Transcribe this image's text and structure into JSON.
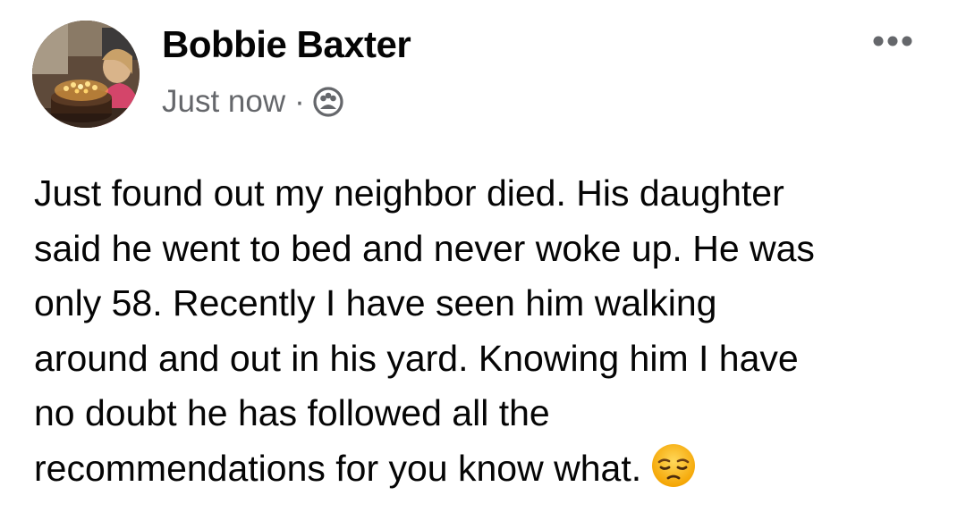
{
  "post": {
    "author": {
      "name": "Bobbie Baxter",
      "avatar_icon": "profile-photo-birthday-cake"
    },
    "meta": {
      "timestamp": "Just now",
      "separator": "·",
      "audience_icon": "friends-audience-icon"
    },
    "menu_icon": "more-options-icon",
    "lines": [
      "Just found out my neighbor died. His daughter",
      "said he went to bed and never woke up. He was",
      "only 58. Recently I have seen him walking",
      "around and out in his yard. Knowing him I have",
      "no doubt he has followed all the",
      "recommendations for you know what."
    ],
    "emoji": "pensive-face-emoji"
  },
  "colors": {
    "text": "#050505",
    "secondary_text": "#65676b",
    "background": "#ffffff"
  }
}
